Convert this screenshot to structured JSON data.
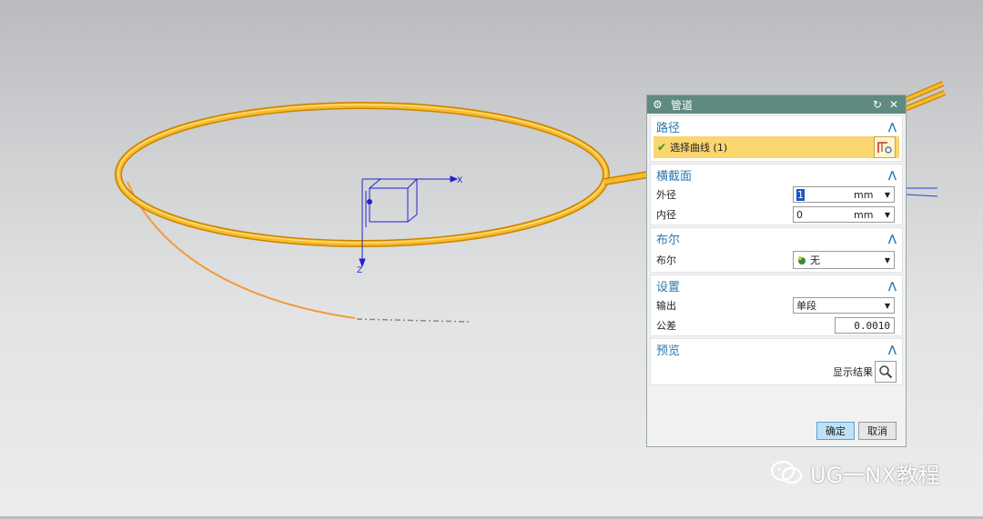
{
  "dialog": {
    "title": "管道",
    "path": {
      "header": "路径",
      "select_label": "选择曲线 (1)"
    },
    "section": {
      "header": "横截面",
      "outer": {
        "label": "外径",
        "value": "1",
        "unit": "mm"
      },
      "inner": {
        "label": "内径",
        "value": "0",
        "unit": "mm"
      }
    },
    "boolean": {
      "header": "布尔",
      "label": "布尔",
      "value": "无"
    },
    "settings": {
      "header": "设置",
      "output_label": "输出",
      "output_value": "单段",
      "tolerance_label": "公差",
      "tolerance_value": "0.0010"
    },
    "preview": {
      "header": "预览",
      "show_result_label": "显示结果"
    },
    "ok_label": "确定",
    "cancel_label": "取消"
  },
  "csys": {
    "x": "X",
    "z": "Z"
  },
  "watermark": "UG一NX教程",
  "colors": {
    "pipe": "#f5b21f",
    "title_bar": "#5e8a7f",
    "accent": "#2b78b3",
    "csys": "#2222cc"
  }
}
